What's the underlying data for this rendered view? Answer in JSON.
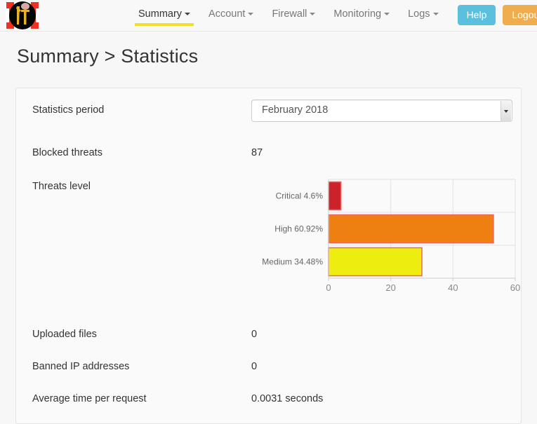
{
  "navbar": {
    "logo_name": "app-logo",
    "items": [
      {
        "label": "Summary",
        "active": true,
        "caret": true
      },
      {
        "label": "Account",
        "active": false,
        "caret": true
      },
      {
        "label": "Firewall",
        "active": false,
        "caret": true
      },
      {
        "label": "Monitoring",
        "active": false,
        "caret": true
      },
      {
        "label": "Logs",
        "active": false,
        "caret": true
      }
    ],
    "help_label": "Help",
    "logout_label": "Logout",
    "help_color": "#5bc0de",
    "logout_color": "#f0ad4e",
    "active_underline_color": "#f0df2a"
  },
  "page": {
    "title": "Summary > Statistics"
  },
  "statistics": {
    "period": {
      "label": "Statistics period",
      "selected": "February 2018"
    },
    "blocked_threats": {
      "label": "Blocked threats",
      "value": "87"
    },
    "threats_level": {
      "label": "Threats level"
    },
    "uploaded_files": {
      "label": "Uploaded files",
      "value": "0"
    },
    "banned_ips": {
      "label": "Banned IP addresses",
      "value": "0"
    },
    "avg_time": {
      "label": "Average time per request",
      "value": "0.0031 seconds"
    }
  },
  "chart_data": {
    "type": "bar",
    "orientation": "horizontal",
    "title": "",
    "xlabel": "",
    "ylabel": "",
    "categories": [
      "Critical 4.6%",
      "High 60.92%",
      "Medium 34.48%"
    ],
    "values": [
      4,
      53,
      30
    ],
    "bar_colors": [
      "#cc2229",
      "#ee8011",
      "#eded10"
    ],
    "bar_border_color": "#f4645f",
    "xlim": [
      0,
      60
    ],
    "xticks": [
      0,
      20,
      40,
      60
    ],
    "xtick_labels": [
      "0",
      "20",
      "40",
      "60"
    ],
    "grid": true,
    "legend": false
  }
}
